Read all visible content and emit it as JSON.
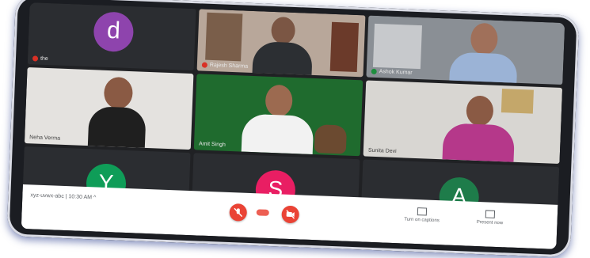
{
  "tiles": {
    "top_left": {
      "avatar_letter": "d",
      "avatar_color": "#8e44ad",
      "name": "the"
    },
    "top_mid": {
      "name": "Rajesh Sharma"
    },
    "top_right": {
      "name": "Ashok Kumar"
    },
    "mid_left": {
      "name": "Neha Verma"
    },
    "mid_center": {
      "name": "Amit Singh"
    },
    "mid_right": {
      "name": "Sunita Devi"
    },
    "bottom_left": {
      "avatar_letter": "Y",
      "avatar_color": "#0f9d58"
    },
    "bottom_center": {
      "avatar_letter": "S",
      "avatar_color": "#e91e63"
    },
    "bottom_right": {
      "avatar_letter": "A",
      "avatar_color": "#1e7c4a"
    }
  },
  "bottom_bar": {
    "meeting_info": "xyz-uvwx-abc  |  10:30 AM  ^",
    "mic_label": "mic-off",
    "call_label": "end-call",
    "camera_label": "camera-off",
    "captions_label": "Turn on captions",
    "present_label": "Present now"
  },
  "colors": {
    "background": "#202124",
    "end_call": "#ea4335"
  }
}
